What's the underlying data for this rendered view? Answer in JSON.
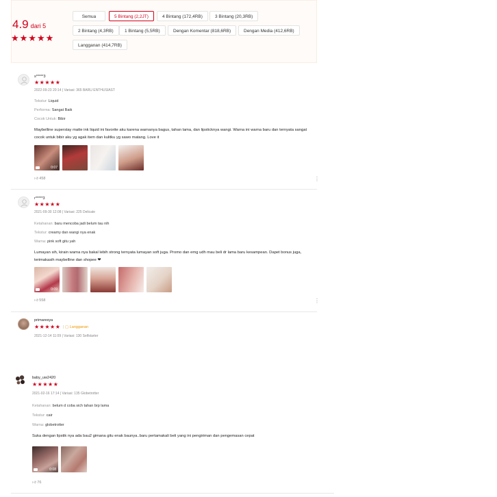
{
  "summary": {
    "score": "4.9",
    "out_of": "dari 5",
    "stars": "★★★★★",
    "filters": {
      "all": "Semua",
      "star5": "5 Bintang (2,2JT)",
      "star4": "4 Bintang (172,4RB)",
      "star3": "3 Bintang (20,3RB)",
      "star2": "2 Bintang (4,3RB)",
      "star1": "1 Bintang (5,5RB)",
      "comment": "Dengan Komentar (818,6RB)",
      "media": "Dengan Media (412,6RB)",
      "subscription": "Langganan (414,7RB)"
    }
  },
  "reviews": [
    {
      "username": "s*****3",
      "stars": "★★★★★",
      "meta": "2022-09-23 20:14 | Variasi: 365 BARU ENTHUSIAST",
      "attrs": [
        {
          "key": "Tekstur: ",
          "value": "Liquid"
        },
        {
          "key": "Performa: ",
          "value": "Sangat Baik"
        },
        {
          "key": "Cocok Untuk: ",
          "value": "Bibir"
        }
      ],
      "text": "Maybelline superstay matte ink liquid ini favorite aku karena warnanya bagus, tahan lama, dan lipsticknya wangi. Warna ini warna baru dan ternyata sangat cocok untuk bibir aku yg agak item dan kulitku yg sawo matang. Love it",
      "video_duration": "0:07",
      "likes": "458"
    },
    {
      "username": "r*****3",
      "stars": "★★★★★",
      "meta": "2021-09-30 12:08 | Variasi: 225 Delicate",
      "attrs": [
        {
          "key": "Ketahanan: ",
          "value": "baru mencoba jadi belum tau nih"
        },
        {
          "key": "Tekstur: ",
          "value": "creamy dan wangi nya enak"
        },
        {
          "key": "Warna: ",
          "value": "pink soft gitu yah"
        }
      ],
      "text": "Lumayan sih, kirain warna nya bakal lebih strong ternyata lumayan soft juga. Promo dan emg udh mau beli dr lama baru kesampean. Dapet bonus juga, terimakasih maybelline dan shopee ❤",
      "video_duration": "0:09",
      "likes": "558"
    },
    {
      "username": "primaresya",
      "stars": "★★★★★",
      "badge": "Langganan",
      "meta": "2021-12-14 11:09 | Variasi: 130 Selfstarter"
    },
    {
      "username": "baby_uw2420",
      "stars": "★★★★★",
      "meta": "2021-02-16 17:14 | Variasi: 135 Globetrotter",
      "attrs": [
        {
          "key": "Ketahanan: ",
          "value": "belum d coba sich tahan brp lama"
        },
        {
          "key": "Tekstur: ",
          "value": "cair"
        },
        {
          "key": "Warna: ",
          "value": "globetrotter"
        }
      ],
      "text": "Suka dengan lipstik nya ada bau2 gimana gitu enak baunya..baru pertamakali beli yang ini pengiriman dan pengemasan cepat",
      "video_duration": "0:08",
      "likes": "76"
    }
  ],
  "colors": {
    "accent": "#d0011b",
    "subscription_badge": "#ee9a00",
    "summary_bg": "#fffbf8"
  },
  "icons": [
    "user-avatar-icon",
    "video-camera-icon",
    "thumbs-up-icon",
    "more-vertical-icon",
    "subscription-bag-icon"
  ]
}
